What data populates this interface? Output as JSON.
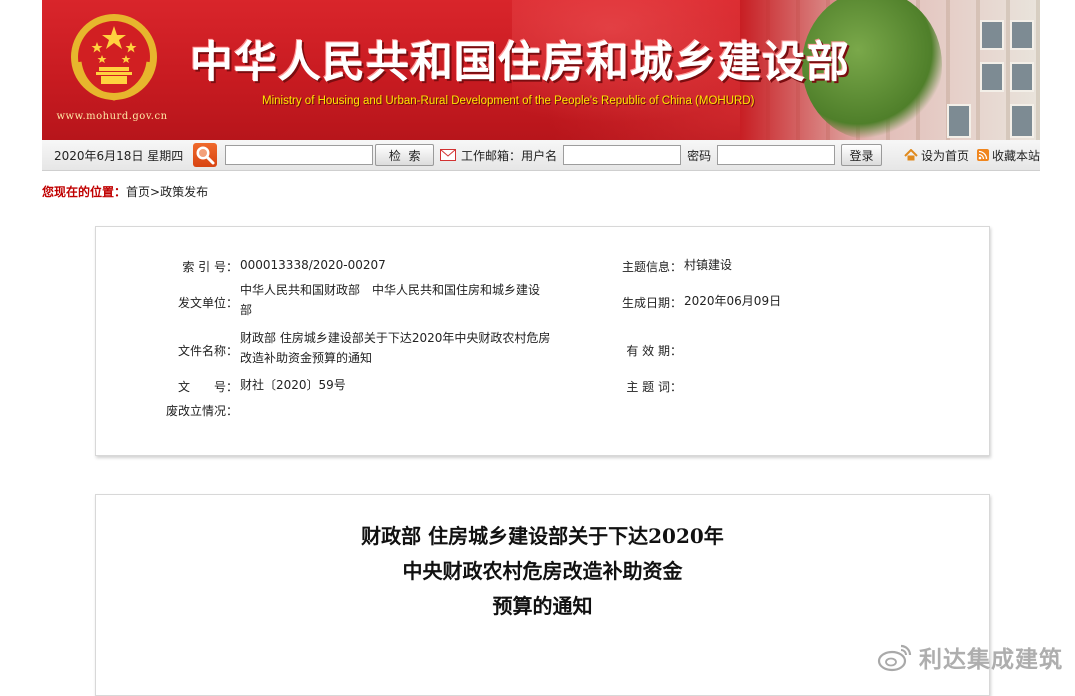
{
  "header": {
    "title_cn": "中华人民共和国住房和城乡建设部",
    "title_en": "Ministry of Housing and Urban-Rural Development of the People's Republic of China (MOHURD)",
    "site_url": "www.mohurd.gov.cn"
  },
  "toolbar": {
    "date": "2020年6月18日 星期四",
    "search_value": "",
    "search_button": "检  索",
    "mail_label": "工作邮箱：",
    "username_label": "用户名",
    "username_value": "",
    "password_label": "密码",
    "password_value": "",
    "login_button": "登录",
    "set_home": "设为首页",
    "bookmark": "收藏本站"
  },
  "breadcrumb": {
    "label": "您现在的位置：",
    "home": "首页",
    "separator": ">",
    "current": "政策发布"
  },
  "info": {
    "index_label": "索 引 号：",
    "index_value": "000013338/2020-00207",
    "issuer_label": "发文单位：",
    "issuer_value": "中华人民共和国财政部　中华人民共和国住房和城乡建设部",
    "docname_label": "文件名称：",
    "docname_value": "财政部 住房城乡建设部关于下达2020年中央财政农村危房改造补助资金预算的通知",
    "docno_label": "文　　号：",
    "docno_value": "财社〔2020〕59号",
    "status_label": "废改立情况：",
    "status_value": "",
    "topic_label": "主题信息：",
    "topic_value": "村镇建设",
    "created_label": "生成日期：",
    "created_value": "2020年06月09日",
    "valid_label": "有 效 期：",
    "valid_value": "",
    "keyword_label": "主 题 词：",
    "keyword_value": ""
  },
  "document": {
    "title_line1": "财政部 住房城乡建设部关于下达2020年",
    "title_line2": "中央财政农村危房改造补助资金",
    "title_line3": "预算的通知"
  },
  "watermark": {
    "text": "利达集成建筑"
  },
  "colors": {
    "banner_red": "#c81b21",
    "title_en_yellow": "#ffe600",
    "breadcrumb_red": "#c00000",
    "search_orange": "#e0531a"
  }
}
